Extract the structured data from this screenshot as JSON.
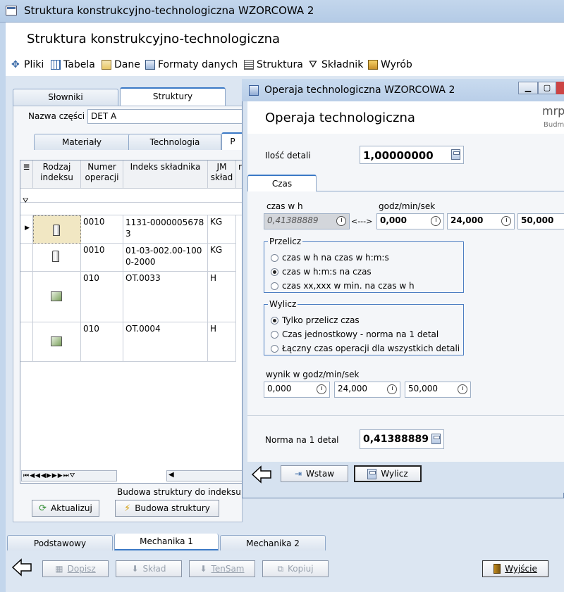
{
  "window": {
    "title": "Struktura konstrukcyjno-technologiczna WZORCOWA 2"
  },
  "header": {
    "title": "Struktura konstrukcyjno-technologiczna"
  },
  "menu": [
    {
      "label": "Pliki",
      "icon": "plug-icon"
    },
    {
      "label": "Tabela",
      "icon": "table-icon"
    },
    {
      "label": "Dane",
      "icon": "data-icon"
    },
    {
      "label": "Formaty danych",
      "icon": "formats-icon"
    },
    {
      "label": "Struktura",
      "icon": "structure-icon"
    },
    {
      "label": "Składnik",
      "icon": "filter-icon"
    },
    {
      "label": "Wyrób",
      "icon": "product-icon"
    }
  ],
  "top_tabs": [
    "Słowniki",
    "Struktury"
  ],
  "part": {
    "label": "Nazwa części",
    "value": "DET A"
  },
  "inner_tabs": [
    "Materiały",
    "Technologia",
    "P"
  ],
  "grid": {
    "columns": [
      "Rodzaj indeksu",
      "Numer operacji",
      "Indeks składnika",
      "JM skład",
      "r"
    ],
    "rows": [
      {
        "icon": "part-icon",
        "op": "0010",
        "index": "1131-00000056783",
        "jm": "KG"
      },
      {
        "icon": "part-icon",
        "op": "0010",
        "index": "01-03-002.00-1000-2000",
        "jm": "KG"
      },
      {
        "icon": "operation-icon",
        "op": "010",
        "index": "OT.0033",
        "jm": "H"
      },
      {
        "icon": "operation-icon",
        "op": "010",
        "index": "OT.0004",
        "jm": "H"
      }
    ]
  },
  "struct_caption": "Budowa struktury do indeksu",
  "buttons": {
    "refresh": "Aktualizuj",
    "build": "Budowa struktury"
  },
  "bottom_tabs": [
    "Podstawowy",
    "Mechanika 1",
    "Mechanika 2"
  ],
  "footer": {
    "add": "Dopisz",
    "compose": "Skład",
    "tensam": "TenSam",
    "copy": "Kopiuj",
    "exit": "Wyjście"
  },
  "dialog": {
    "title": "Operaja technologiczna WZORCOWA 2",
    "header": "Operaja technologiczna",
    "brand": "mrp",
    "brand_sub": "Budm",
    "qty_label": "Ilość detali",
    "qty_value": "1,00000000",
    "tab": "Czas",
    "czas_h_label": "czas w h",
    "czas_h_value": "0,41388889",
    "arrow": "<--->",
    "hms_label": "godz/min/sek",
    "hms": [
      "0,000",
      "24,000",
      "50,000"
    ],
    "przelicz": {
      "title": "Przelicz",
      "options": [
        "czas w h na czas w h:m:s",
        "czas w h:m:s na czas",
        "czas xx,xxx w min. na czas w h"
      ],
      "selected": 1
    },
    "wylicz": {
      "title": "Wylicz",
      "options": [
        "Tylko przelicz czas",
        "Czas jednostkowy - norma na 1 detal",
        "Łączny czas operacji dla wszystkich detali"
      ],
      "selected": 0
    },
    "wynik_label": "wynik w godz/min/sek",
    "wynik": [
      "0,000",
      "24,000",
      "50,000"
    ],
    "norma_label": "Norma na 1 detal",
    "norma_value": "0,41388889",
    "insert": "Wstaw",
    "calculate": "Wylicz"
  }
}
